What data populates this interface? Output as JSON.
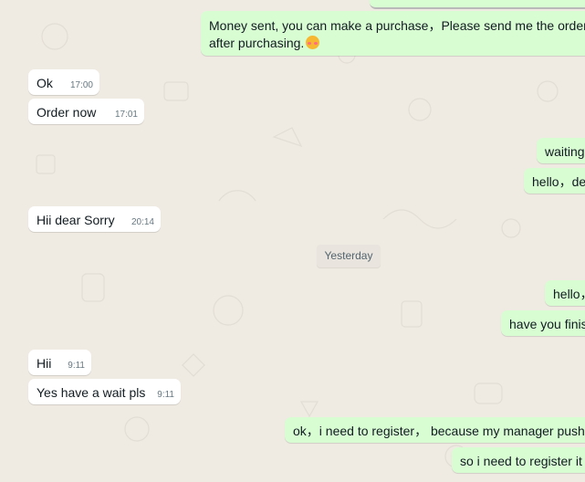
{
  "chat": {
    "day_divider": "Yesterday",
    "messages": [
      {
        "direction": "outgoing",
        "text": "Money sent, you can make a purchase，Please send me the order n",
        "text2": "after purchasing."
      },
      {
        "direction": "incoming",
        "text": "Ok",
        "time": "17:00"
      },
      {
        "direction": "incoming",
        "text": "Order now",
        "time": "17:01"
      },
      {
        "direction": "outgoing",
        "text": "waiting"
      },
      {
        "direction": "outgoing",
        "text": "hello，de"
      },
      {
        "direction": "incoming",
        "text": "Hii dear Sorry",
        "time": "20:14"
      },
      {
        "direction": "outgoing",
        "text": "hello，"
      },
      {
        "direction": "outgoing",
        "text": "have you finis"
      },
      {
        "direction": "incoming",
        "text": "Hii",
        "time": "9:11"
      },
      {
        "direction": "incoming",
        "text": "Yes have a wait pls",
        "time": "9:11"
      },
      {
        "direction": "outgoing",
        "text": "ok，i need to register， because my manager pushe"
      },
      {
        "direction": "outgoing",
        "text": "so i need to register it"
      }
    ]
  },
  "colors": {
    "background": "#efeae2",
    "incoming_bubble": "#ffffff",
    "outgoing_bubble": "#d9fdd3",
    "timestamp": "#667781"
  },
  "icons": {
    "emoji": "smiling-face-with-hearts-icon"
  }
}
